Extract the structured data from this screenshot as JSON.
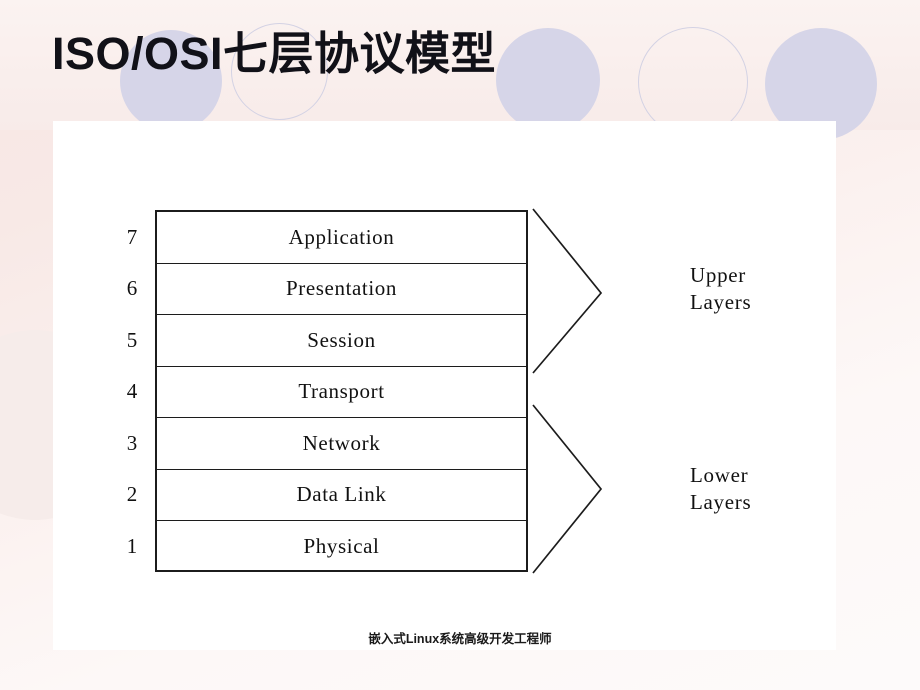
{
  "slide": {
    "title": "ISO/OSI七层协议模型",
    "footer": "嵌入式Linux系统高级开发工程师"
  },
  "theme": {
    "background_start": "#f7e6e4",
    "background_end": "#fdfafa",
    "circle_fill": "#d6d5e8",
    "circle_ring": "#d3d2e4",
    "panel_bg": "#ffffff",
    "ink": "#111111"
  },
  "diagram": {
    "layers": [
      {
        "number": "7",
        "name": "Application"
      },
      {
        "number": "6",
        "name": "Presentation"
      },
      {
        "number": "5",
        "name": "Session"
      },
      {
        "number": "4",
        "name": "Transport"
      },
      {
        "number": "3",
        "name": "Network"
      },
      {
        "number": "2",
        "name": "Data Link"
      },
      {
        "number": "1",
        "name": "Physical"
      }
    ],
    "groups": {
      "upper": "Upper\nLayers",
      "lower": "Lower\nLayers"
    }
  }
}
